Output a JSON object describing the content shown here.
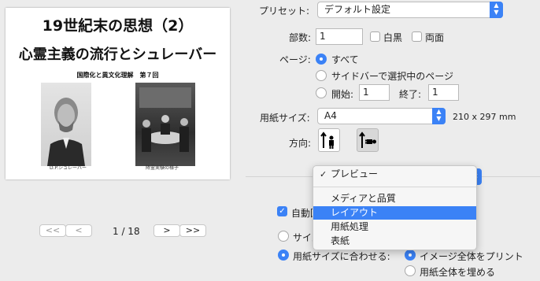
{
  "preview": {
    "doc_title_line1": "19世紀末の思想（2）",
    "doc_title_line2": "心霊主義の流行とシュレーバー",
    "doc_subtitle": "国際化と異文化理解　第７回",
    "caption_left": "D.P.シュレーバー",
    "caption_right": "降霊実験の様子"
  },
  "pager": {
    "first": "<<",
    "prev": "<",
    "page_indicator": "1 / 18",
    "next": ">",
    "last": ">>"
  },
  "presets": {
    "label": "プリセット:",
    "value": "デフォルト設定"
  },
  "copies": {
    "label": "部数:",
    "value": "1",
    "bw_label": "白黒",
    "duplex_label": "両面"
  },
  "pages": {
    "label": "ページ:",
    "all_label": "すべて",
    "sidebar_label": "サイドバーで選択中のページ",
    "from_label": "開始:",
    "from_value": "1",
    "to_label": "終了:",
    "to_value": "1"
  },
  "paper": {
    "label": "用紙サイズ:",
    "value": "A4",
    "dimensions": "210 x 297 mm"
  },
  "orientation": {
    "label": "方向:"
  },
  "section_menu": {
    "items": [
      "プレビュー",
      "メディアと品質",
      "レイアウト",
      "用紙処理",
      "表紙"
    ],
    "checked": "プレビュー",
    "highlighted": "レイアウト"
  },
  "options": {
    "auto_rotate_partial": "自動回",
    "scale_partial": "サイズ",
    "fit_label": "用紙サイズに合わせる:",
    "print_entire": "イメージ全体をプリント",
    "fill_entire": "用紙全体を埋める"
  },
  "colors": {
    "accent": "#3b82f6",
    "background": "#ececec"
  }
}
